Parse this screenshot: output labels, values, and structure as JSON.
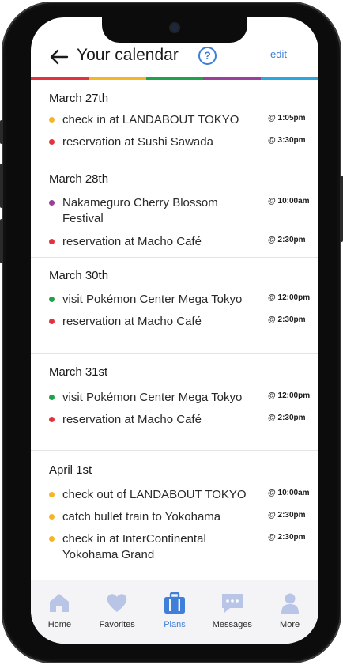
{
  "header": {
    "title": "Your calendar",
    "help_glyph": "?",
    "edit_label": "edit",
    "back_icon": "arrow-left-icon"
  },
  "colors": {
    "accent": "#3f7fd9",
    "dot_yellow": "#f5b625",
    "dot_red": "#e3323c",
    "dot_purple": "#9a3f9c",
    "dot_green": "#1fa34a",
    "stripes": [
      "#e3323c",
      "#f5b625",
      "#1fa34a",
      "#9a3f9c",
      "#2aa7df"
    ],
    "tab_inactive": "#b9c5e6"
  },
  "days": [
    {
      "date": "March 27th",
      "events": [
        {
          "title": "check in at LANDABOUT TOKYO",
          "time": "@ 1:05pm",
          "dot": "yellow"
        },
        {
          "title": "reservation at Sushi Sawada",
          "time": "@ 3:30pm",
          "dot": "red"
        }
      ]
    },
    {
      "date": "March 28th",
      "events": [
        {
          "title": "Nakameguro Cherry Blossom Festival",
          "time": "@ 10:00am",
          "dot": "purple"
        },
        {
          "title": "reservation at Macho Café",
          "time": "@ 2:30pm",
          "dot": "red"
        }
      ]
    },
    {
      "date": "March 30th",
      "events": [
        {
          "title": "visit Pokémon Center Mega Tokyo",
          "time": "@ 12:00pm",
          "dot": "green"
        },
        {
          "title": "reservation at Macho Café",
          "time": "@ 2:30pm",
          "dot": "red"
        }
      ]
    },
    {
      "date": "March 31st",
      "events": [
        {
          "title": "visit Pokémon Center Mega Tokyo",
          "time": "@ 12:00pm",
          "dot": "green"
        },
        {
          "title": "reservation at Macho Café",
          "time": "@ 2:30pm",
          "dot": "red"
        }
      ]
    },
    {
      "date": "April 1st",
      "events": [
        {
          "title": "check out of LANDABOUT TOKYO",
          "time": "@ 10:00am",
          "dot": "yellow"
        },
        {
          "title": "catch bullet train to Yokohama",
          "time": "@ 2:30pm",
          "dot": "yellow"
        },
        {
          "title": "check in at InterContinental Yokohama Grand",
          "time": "@ 2:30pm",
          "dot": "yellow"
        }
      ]
    }
  ],
  "tabs": [
    {
      "label": "Home",
      "icon": "home-icon",
      "active": false
    },
    {
      "label": "Favorites",
      "icon": "heart-icon",
      "active": false
    },
    {
      "label": "Plans",
      "icon": "suitcase-icon",
      "active": true
    },
    {
      "label": "Messages",
      "icon": "chat-bubble-icon",
      "active": false
    },
    {
      "label": "More",
      "icon": "person-icon",
      "active": false
    }
  ]
}
